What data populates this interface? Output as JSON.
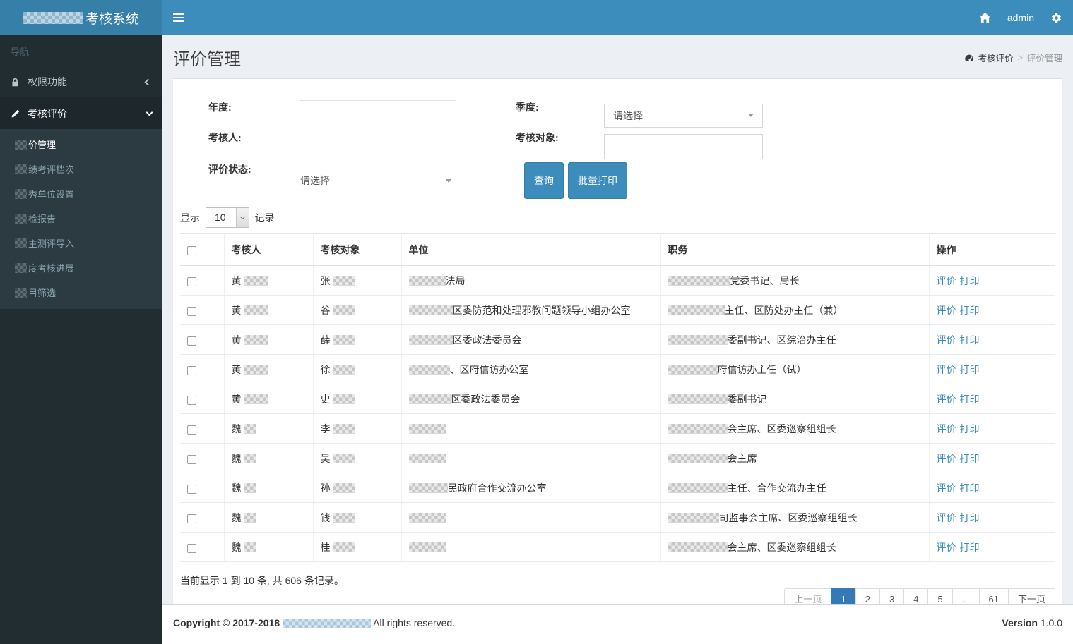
{
  "header": {
    "logo_text": "考核系统",
    "user": "admin"
  },
  "sidebar": {
    "nav_label": "导航",
    "items": [
      {
        "label": "权限功能",
        "icon": "lock-icon",
        "state": "collapsed"
      },
      {
        "label": "考核评价",
        "icon": "pencil-icon",
        "state": "expanded"
      }
    ],
    "subitems": [
      {
        "label": "价管理",
        "active": true
      },
      {
        "label": "绩考评档次",
        "active": false
      },
      {
        "label": "秀单位设置",
        "active": false
      },
      {
        "label": "检报告",
        "active": false
      },
      {
        "label": "主测评导入",
        "active": false
      },
      {
        "label": "度考核进展",
        "active": false
      },
      {
        "label": "目筛选",
        "active": false
      }
    ]
  },
  "page": {
    "title": "评价管理",
    "breadcrumb_parent": "考核评价",
    "breadcrumb_current": "评价管理"
  },
  "filters": {
    "year_label": "年度:",
    "quarter_label": "季度:",
    "assessor_label": "考核人:",
    "target_label": "考核对象:",
    "status_label": "评价状态:",
    "quarter_value": "请选择",
    "status_value": "请选择",
    "search_btn": "查询",
    "batch_print_btn": "批量打印"
  },
  "list_controls": {
    "show_label": "显示",
    "page_size": "10",
    "records_label": "记录"
  },
  "table": {
    "columns": [
      "考核人",
      "考核对象",
      "单位",
      "职务",
      "操作"
    ],
    "action_links": [
      "评价",
      "打印"
    ],
    "rows": [
      {
        "assessor": "黄",
        "assessor_redact": 34,
        "target": "张",
        "target_redact": 32,
        "unit_redact": 52,
        "unit": "法局",
        "duty_redact": 88,
        "duty": "党委书记、局长"
      },
      {
        "assessor": "黄",
        "assessor_redact": 34,
        "target": "谷",
        "target_redact": 32,
        "unit_redact": 62,
        "unit": "区委防范和处理邪教问题领导小组办公室",
        "duty_redact": 80,
        "duty": "主任、区防处办主任（兼）"
      },
      {
        "assessor": "黄",
        "assessor_redact": 34,
        "target": "薛",
        "target_redact": 32,
        "unit_redact": 62,
        "unit": "区委政法委员会",
        "duty_redact": 84,
        "duty": "委副书记、区综治办主任"
      },
      {
        "assessor": "黄",
        "assessor_redact": 34,
        "target": "徐",
        "target_redact": 32,
        "unit_redact": 58,
        "unit": "、区府信访办公室",
        "duty_redact": 70,
        "duty": "府信访办主任（试）"
      },
      {
        "assessor": "黄",
        "assessor_redact": 34,
        "target": "史",
        "target_redact": 32,
        "unit_redact": 60,
        "unit": "区委政法委员会",
        "duty_redact": 84,
        "duty": "委副书记"
      },
      {
        "assessor": "魏",
        "assessor_redact": 18,
        "target": "李",
        "target_redact": 32,
        "unit_redact": 52,
        "unit": "",
        "duty_redact": 84,
        "duty": "会主席、区委巡察组组长"
      },
      {
        "assessor": "魏",
        "assessor_redact": 18,
        "target": "吴",
        "target_redact": 32,
        "unit_redact": 52,
        "unit": "",
        "duty_redact": 84,
        "duty": "会主席"
      },
      {
        "assessor": "魏",
        "assessor_redact": 18,
        "target": "孙",
        "target_redact": 32,
        "unit_redact": 55,
        "unit": "民政府合作交流办公室",
        "duty_redact": 84,
        "duty": "主任、合作交流办主任"
      },
      {
        "assessor": "魏",
        "assessor_redact": 18,
        "target": "钱",
        "target_redact": 32,
        "unit_redact": 52,
        "unit": "",
        "duty_redact": 72,
        "duty": "司监事会主席、区委巡察组组长"
      },
      {
        "assessor": "魏",
        "assessor_redact": 18,
        "target": "桂",
        "target_redact": 32,
        "unit_redact": 52,
        "unit": "",
        "duty_redact": 84,
        "duty": "会主席、区委巡察组组长"
      }
    ]
  },
  "pagination": {
    "summary": "当前显示 1 到 10 条, 共 606 条记录。",
    "prev": "上一页",
    "next": "下一页",
    "pages": [
      "1",
      "2",
      "3",
      "4",
      "5",
      "...",
      "61"
    ],
    "active_page": "1"
  },
  "footer": {
    "copyright_prefix": "Copyright © 2017-2018",
    "copyright_suffix": "All rights reserved.",
    "version_label": "Version",
    "version": "1.0.0"
  },
  "colors": {
    "navbar": "#3c8dbc",
    "logo_bg": "#367fa9",
    "sidebar_bg": "#222d32",
    "submenu_bg": "#2c3b41",
    "active_menu_bg": "#1e282c",
    "accent": "#3c8dbc",
    "active_page_bg": "#337ab7",
    "content_bg": "#ecf0f5"
  }
}
